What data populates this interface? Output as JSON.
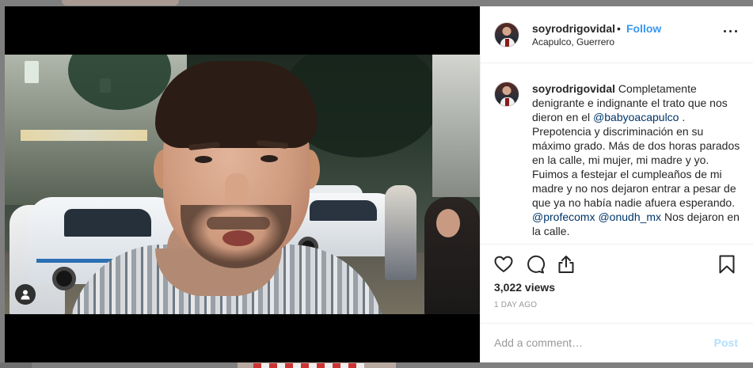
{
  "post": {
    "username": "soyrodrigovidal",
    "separator": "•",
    "follow_label": "Follow",
    "location": "Acapulco, Guerrero",
    "more_icon": "more-horizontal-icon"
  },
  "caption": {
    "username": "soyrodrigovidal",
    "text_1": " Completamente denigrante e indignante el trato que nos dieron en el ",
    "mention_1": "@babyoacapulco",
    "text_2": " . Prepotencia y discriminación en su máximo grado. Más de dos horas parados en la calle, mi mujer, mi madre y yo. Fuimos a festejar el cumpleaños de mi madre y no nos dejaron entrar a pesar de que ya no había nadie afuera esperando. ",
    "mention_2": "@profecomx",
    "text_3": " ",
    "mention_3": "@onudh_mx",
    "text_4": " Nos dejaron en la calle."
  },
  "actions": {
    "icons": [
      "heart-icon",
      "comment-icon",
      "share-icon",
      "bookmark-icon"
    ],
    "views": "3,022 views",
    "date": "1 DAY AGO"
  },
  "comment_box": {
    "placeholder": "Add a comment…",
    "post_label": "Post"
  },
  "colors": {
    "follow": "#3897f0",
    "mention": "#003569",
    "post_disabled": "#b2dffc",
    "text": "#262626",
    "muted": "#999999"
  }
}
